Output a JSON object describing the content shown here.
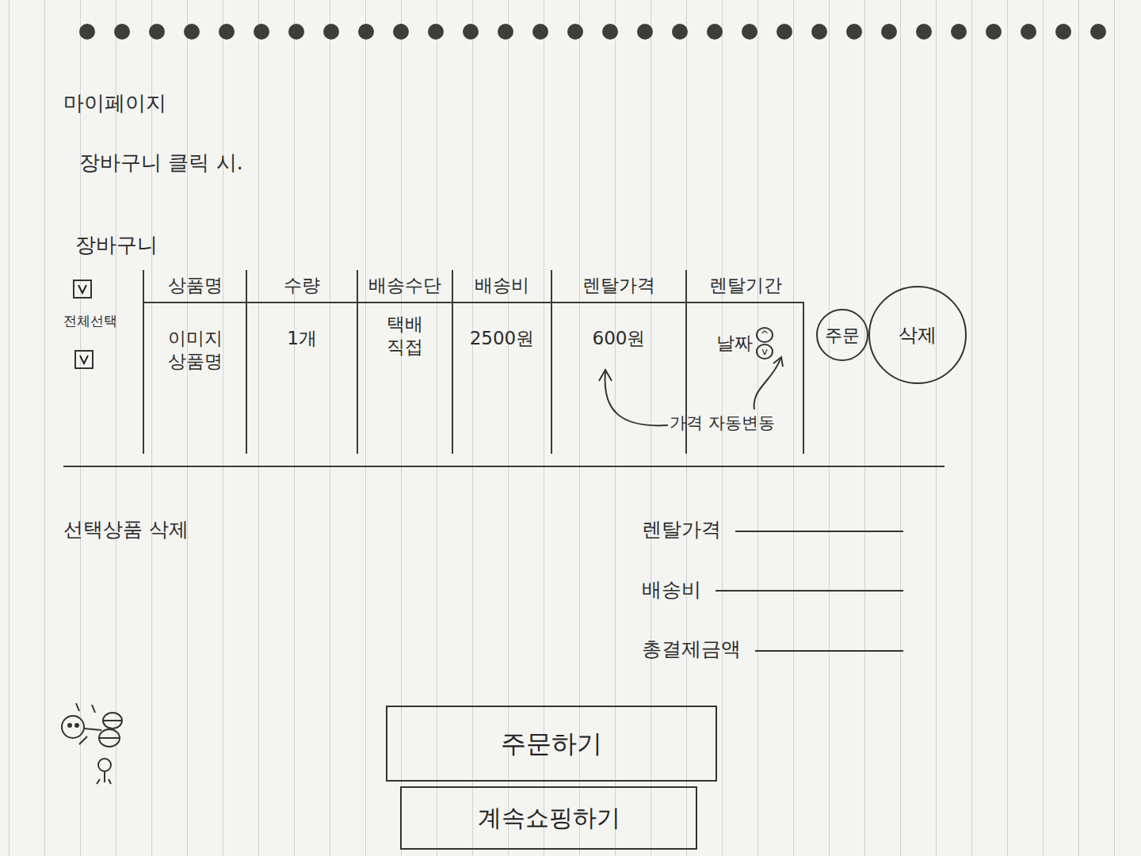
{
  "page": {
    "title": "마이페이지",
    "note": "장바구니 클릭 시."
  },
  "cart": {
    "title": "장바구니",
    "select_all": {
      "label": "전체선택",
      "checked": true
    },
    "columns": [
      "상품명",
      "수량",
      "배송수단",
      "배송비",
      "렌탈가격",
      "렌탈기간"
    ],
    "rows": [
      {
        "checked": true,
        "image": "이미지",
        "name": "상품명",
        "quantity": "1개",
        "delivery": [
          "택배",
          "직접"
        ],
        "shipping": "2500원",
        "price": "600원",
        "period": "날짜",
        "spin_up": "^",
        "spin_down": "v",
        "order": "주문",
        "delete": "삭제"
      }
    ]
  },
  "annotation": "가격 자동변동",
  "delete_selected": "선택상품 삭제",
  "summary": [
    "렌탈가격",
    "배송비",
    "총결제금액"
  ],
  "buttons": [
    "주문하기",
    "계속쇼핑하기"
  ]
}
